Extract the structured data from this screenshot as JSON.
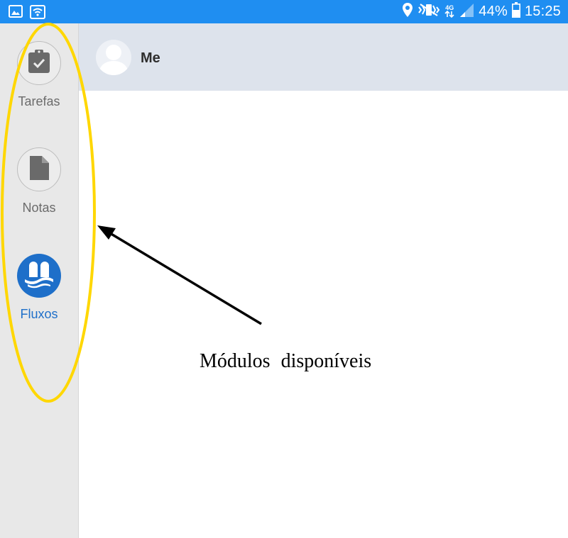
{
  "status_bar": {
    "signal_type": "4G",
    "battery": "44%",
    "time": "15:25",
    "icons": [
      "gallery-icon",
      "wifi-icon",
      "location-icon",
      "vibrate-icon",
      "data-arrows-icon",
      "signal-icon",
      "battery-icon"
    ]
  },
  "sidebar": {
    "modules": [
      {
        "label": "Tarefas",
        "icon": "clipboard-check-icon",
        "active": false
      },
      {
        "label": "Notas",
        "icon": "note-icon",
        "active": false
      },
      {
        "label": "Fluxos",
        "icon": "flows-icon",
        "active": true
      }
    ]
  },
  "header": {
    "name": "Me"
  },
  "annotation": {
    "caption": "Módulos disponíveis"
  },
  "colors": {
    "status_bar": "#1f8ef1",
    "accent": "#1e6fc9",
    "highlight_ellipse": "#ffd700",
    "header_bg": "#dde3ec",
    "sidebar_bg": "#e8e8e8"
  }
}
